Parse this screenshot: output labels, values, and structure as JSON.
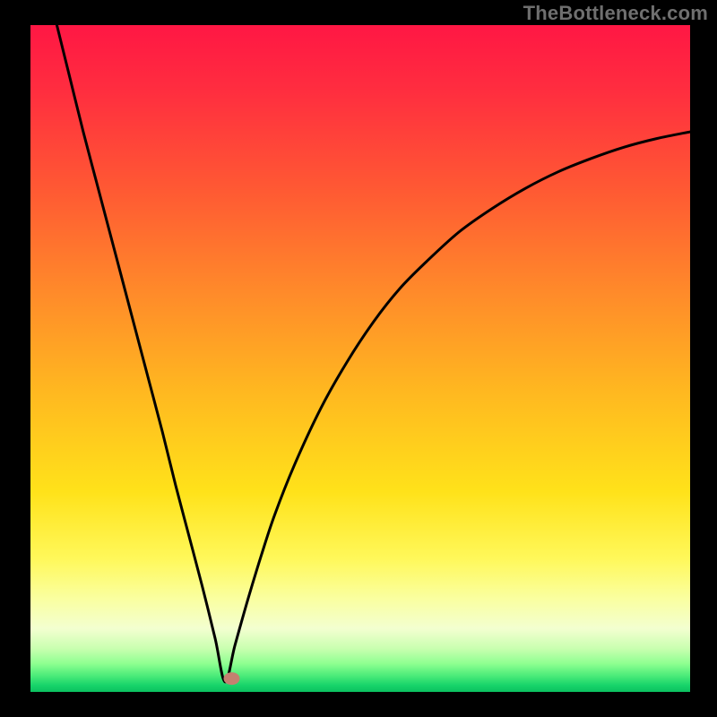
{
  "watermark": "TheBottleneck.com",
  "chart_data": {
    "type": "line",
    "title": "",
    "xlabel": "",
    "ylabel": "",
    "xlim": [
      0,
      100
    ],
    "ylim": [
      0,
      100
    ],
    "minimum_x": 29.5,
    "minimum_marker": {
      "x": 30.5,
      "y": 2
    },
    "series": [
      {
        "name": "bottleneck-curve",
        "x": [
          4,
          6,
          8,
          10,
          12,
          14,
          16,
          18,
          20,
          22,
          24,
          26,
          28,
          29.5,
          31,
          33,
          35,
          37,
          40,
          44,
          48,
          52,
          56,
          60,
          65,
          70,
          75,
          80,
          85,
          90,
          95,
          100
        ],
        "values": [
          100,
          92,
          84,
          76.5,
          69,
          61.5,
          54,
          46.5,
          39,
          31,
          23.5,
          16,
          8,
          1.5,
          7,
          14,
          20.5,
          26.5,
          34,
          42.5,
          49.5,
          55.5,
          60.5,
          64.5,
          69,
          72.5,
          75.5,
          78,
          80,
          81.7,
          83,
          84
        ]
      }
    ],
    "background_gradient": {
      "stops": [
        {
          "offset": 0.0,
          "color": "#ff1744"
        },
        {
          "offset": 0.1,
          "color": "#ff2e3f"
        },
        {
          "offset": 0.25,
          "color": "#ff5a33"
        },
        {
          "offset": 0.4,
          "color": "#ff8a2a"
        },
        {
          "offset": 0.55,
          "color": "#ffb820"
        },
        {
          "offset": 0.7,
          "color": "#ffe21a"
        },
        {
          "offset": 0.8,
          "color": "#fff85a"
        },
        {
          "offset": 0.86,
          "color": "#faffa0"
        },
        {
          "offset": 0.905,
          "color": "#f3ffd0"
        },
        {
          "offset": 0.935,
          "color": "#c9ffb0"
        },
        {
          "offset": 0.958,
          "color": "#8dff90"
        },
        {
          "offset": 0.975,
          "color": "#4eec7a"
        },
        {
          "offset": 0.99,
          "color": "#18d46a"
        },
        {
          "offset": 1.0,
          "color": "#0bc060"
        }
      ]
    },
    "marker_color": "#c48070"
  }
}
